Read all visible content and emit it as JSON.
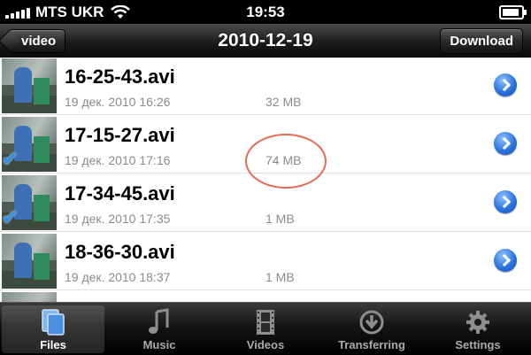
{
  "status_bar": {
    "carrier": "MTS UKR",
    "time": "19:53",
    "icons": [
      "signal-icon",
      "wifi-icon",
      "battery-icon"
    ]
  },
  "nav_bar": {
    "back_label": "video",
    "title": "2010-12-19",
    "download_label": "Download"
  },
  "files": [
    {
      "name": "16-25-43.avi",
      "date": "19 дек. 2010 16:26",
      "size": "32 MB",
      "checked": false
    },
    {
      "name": "17-15-27.avi",
      "date": "19 дек. 2010 17:16",
      "size": "74 MB",
      "checked": true
    },
    {
      "name": "17-34-45.avi",
      "date": "19 дек. 2010 17:35",
      "size": "1 MB",
      "checked": true
    },
    {
      "name": "18-36-30.avi",
      "date": "19 дек. 2010 18:37",
      "size": "1 MB",
      "checked": false
    }
  ],
  "tab_bar": {
    "tabs": [
      {
        "label": "Files",
        "icon": "files-icon",
        "active": true
      },
      {
        "label": "Music",
        "icon": "music-note-icon",
        "active": false
      },
      {
        "label": "Videos",
        "icon": "film-icon",
        "active": false
      },
      {
        "label": "Transferring",
        "icon": "download-arrow-icon",
        "active": false
      },
      {
        "label": "Settings",
        "icon": "gear-icon",
        "active": false
      }
    ]
  },
  "colors": {
    "accent_blue": "#2b73de",
    "annotation_red": "#e8694f",
    "secondary_text": "#8a8a8a"
  }
}
